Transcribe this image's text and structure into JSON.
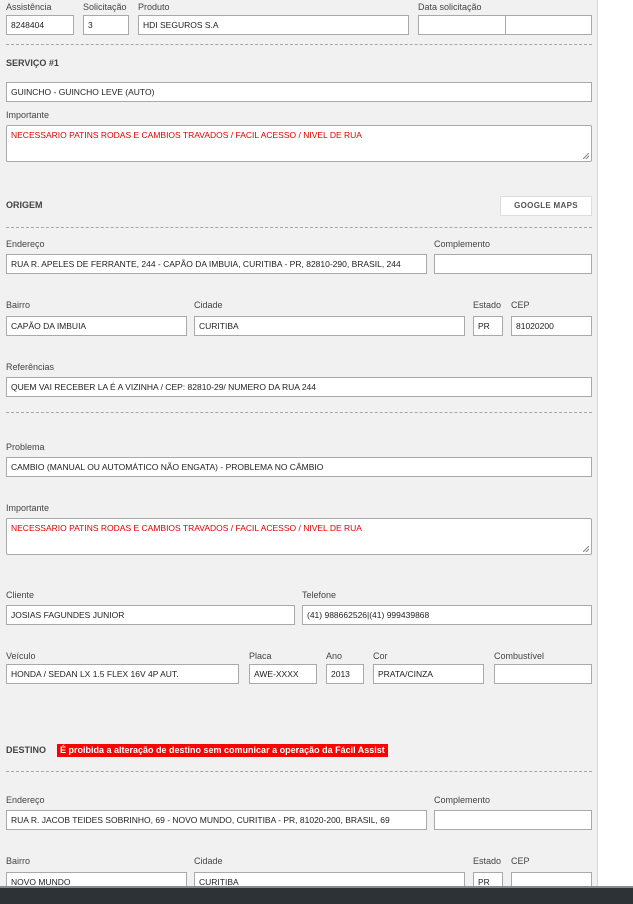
{
  "header": {
    "assistencia_label": "Assistência",
    "assistencia": "8248404",
    "solicitacao_label": "Solicitação",
    "solicitacao": "3",
    "produto_label": "Produto",
    "produto": "HDI SEGUROS S.A",
    "data_label": "Data solicitação",
    "data": "",
    "hora": ""
  },
  "servico": {
    "title": "SERVIÇO #1",
    "tipo": "GUINCHO - GUINCHO LEVE (AUTO)",
    "importante_label": "Importante",
    "importante": "NECESSARIO PATINS RODAS E CAMBIOS TRAVADOS / FACIL ACESSO / NIVEL DE RUA"
  },
  "origem": {
    "title": "ORIGEM",
    "maps_button": "GOOGLE MAPS",
    "endereco_label": "Endereço",
    "endereco": "RUA R. APELES DE FERRANTE, 244 - CAPÃO DA IMBUIA, CURITIBA - PR, 82810-290, BRASIL, 244",
    "complemento_label": "Complemento",
    "complemento": "",
    "bairro_label": "Bairro",
    "bairro": "CAPÃO DA IMBUIA",
    "cidade_label": "Cidade",
    "cidade": "CURITIBA",
    "estado_label": "Estado",
    "estado": "PR",
    "cep_label": "CEP",
    "cep": "81020200",
    "referencias_label": "Referências",
    "referencias": "QUEM VAI RECEBER LA É A VIZINHA / CEP: 82810-29/ NUMERO DA RUA 244"
  },
  "problema": {
    "label": "Problema",
    "value": "CAMBIO (MANUAL OU AUTOMÁTICO NÃO ENGATA) - PROBLEMA NO CÂMBIO",
    "importante_label": "Importante",
    "importante": "NECESSARIO PATINS RODAS E CAMBIOS TRAVADOS / FACIL ACESSO / NIVEL DE RUA"
  },
  "cliente": {
    "cliente_label": "Cliente",
    "cliente": "JOSIAS FAGUNDES JUNIOR",
    "telefone_label": "Telefone",
    "telefone": "(41) 988662526|(41) 999439868",
    "veiculo_label": "Veículo",
    "veiculo": "HONDA / SEDAN LX 1.5 FLEX 16V 4P AUT.",
    "placa_label": "Placa",
    "placa": "AWE-XXXX",
    "ano_label": "Ano",
    "ano": "2013",
    "cor_label": "Cor",
    "cor": "PRATA/CINZA",
    "combustivel_label": "Combustível",
    "combustivel": ""
  },
  "destino": {
    "title": "DESTINO",
    "warning": "É proibida a alteração de destino sem comunicar a operação da Fácil Assist",
    "warning_color": "#ff0000",
    "endereco_label": "Endereço",
    "endereco": "RUA R. JACOB TEIDES SOBRINHO, 69 - NOVO MUNDO, CURITIBA - PR, 81020-200, BRASIL, 69",
    "complemento_label": "Complemento",
    "complemento": "",
    "bairro_label": "Bairro",
    "bairro": "NOVO MUNDO",
    "cidade_label": "Cidade",
    "cidade": "CURITIBA",
    "estado_label": "Estado",
    "estado": "PR",
    "cep_label": "CEP",
    "cep": ""
  }
}
